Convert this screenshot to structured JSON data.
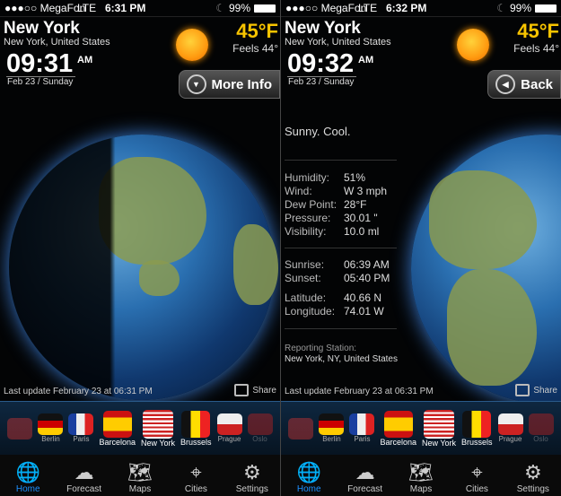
{
  "screens": [
    {
      "status": {
        "carrier": "●●●○○ MegaFon",
        "network": "LTE",
        "time": "6:31 PM",
        "battery": "99%"
      },
      "city": "New York",
      "region": "New York, United States",
      "clock": "09:31",
      "ampm": "AM",
      "date": "Feb 23 / Sunday",
      "temp": "45°F",
      "feels": "Feels 44°",
      "button": "More Info",
      "button_icon": "chevron-down-circle-icon",
      "last_update": "Last update February 23 at 06:31 PM",
      "share": "Share"
    },
    {
      "status": {
        "carrier": "●●●○○ MegaFon",
        "network": "LTE",
        "time": "6:32 PM",
        "battery": "99%"
      },
      "city": "New York",
      "region": "New York, United States",
      "clock": "09:32",
      "ampm": "AM",
      "date": "Feb 23 / Sunday",
      "temp": "45°F",
      "feels": "Feels 44°",
      "button": "Back",
      "button_icon": "chevron-left-circle-icon",
      "condition": "Sunny. Cool.",
      "details": [
        {
          "k": "Humidity:",
          "v": "51%"
        },
        {
          "k": "Wind:",
          "v": "W 3 mph"
        },
        {
          "k": "Dew Point:",
          "v": "28°F"
        },
        {
          "k": "Pressure:",
          "v": "30.01 \""
        },
        {
          "k": "Visibility:",
          "v": "10.0 ml"
        }
      ],
      "sun": [
        {
          "k": "Sunrise:",
          "v": "06:39 AM"
        },
        {
          "k": "Sunset:",
          "v": "05:40 PM"
        }
      ],
      "coords": [
        {
          "k": "Latitude:",
          "v": "40.66 N"
        },
        {
          "k": "Longitude:",
          "v": "74.01 W"
        }
      ],
      "station_label": "Reporting Station:",
      "station": "New York, NY, United States",
      "last_update": "Last update February 23 at 06:31 PM",
      "share": "Share"
    }
  ],
  "flags": [
    {
      "city": "",
      "bg": "linear-gradient(#c33 0,#c33 100%)"
    },
    {
      "city": "Berlin",
      "bg": "linear-gradient(#111 33%,#c00 33%,#c00 66%,#fc0 66%)"
    },
    {
      "city": "Paris",
      "bg": "linear-gradient(90deg,#1a3fa0 33%,#eee 33%,#eee 66%,#d22 66%)"
    },
    {
      "city": "Barcelona",
      "bg": "linear-gradient(#c11 25%,#fc0 25%,#fc0 75%,#c11 75%)"
    },
    {
      "city": "New York",
      "bg": "repeating-linear-gradient(#c22 0,#c22 2.3px,#fff 2.3px,#fff 4.6px)"
    },
    {
      "city": "Brussels",
      "bg": "linear-gradient(90deg,#111 33%,#fd0 33%,#fd0 66%,#e22 66%)"
    },
    {
      "city": "Prague",
      "bg": "linear-gradient(#eee 50%,#c22 50%)"
    },
    {
      "city": "Oslo",
      "bg": "linear-gradient(#b22,#b22)"
    }
  ],
  "tabs": [
    {
      "label": "Home",
      "icon": "globe-icon",
      "glyph": "🌐"
    },
    {
      "label": "Forecast",
      "icon": "cloud-sun-icon",
      "glyph": "☁"
    },
    {
      "label": "Maps",
      "icon": "map-icon",
      "glyph": "🗺"
    },
    {
      "label": "Cities",
      "icon": "map-pin-icon",
      "glyph": "⌖"
    },
    {
      "label": "Settings",
      "icon": "gear-icon",
      "glyph": "⚙"
    }
  ],
  "colors": {
    "accent": "#1e90ff",
    "temp": "#f8c400"
  }
}
